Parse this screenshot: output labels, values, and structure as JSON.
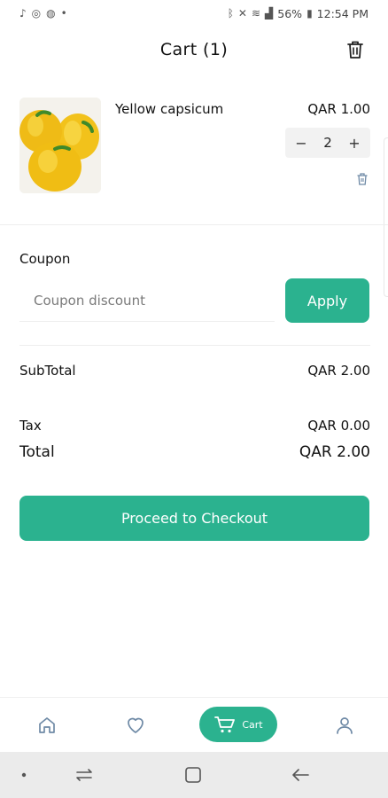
{
  "status_bar": {
    "left_icons": [
      "music-note-icon",
      "at-icon",
      "globe-icon",
      "dot-icon"
    ],
    "battery": "56%",
    "time": "12:54 PM"
  },
  "header": {
    "title": "Cart (1)"
  },
  "cart_items": [
    {
      "name": "Yellow capsicum",
      "price": "QAR 1.00",
      "quantity": "2",
      "minus": "−",
      "plus": "+"
    }
  ],
  "coupon": {
    "label": "Coupon",
    "placeholder": "Coupon discount",
    "apply_label": "Apply"
  },
  "summary": {
    "subtotal_label": "SubTotal",
    "subtotal_value": "QAR 2.00",
    "tax_label": "Tax",
    "tax_value": "QAR 0.00",
    "total_label": "Total",
    "total_value": "QAR 2.00"
  },
  "checkout": {
    "label": "Proceed to Checkout"
  },
  "bottom_nav": {
    "cart_label": "Cart"
  },
  "colors": {
    "accent": "#2bb28f"
  }
}
